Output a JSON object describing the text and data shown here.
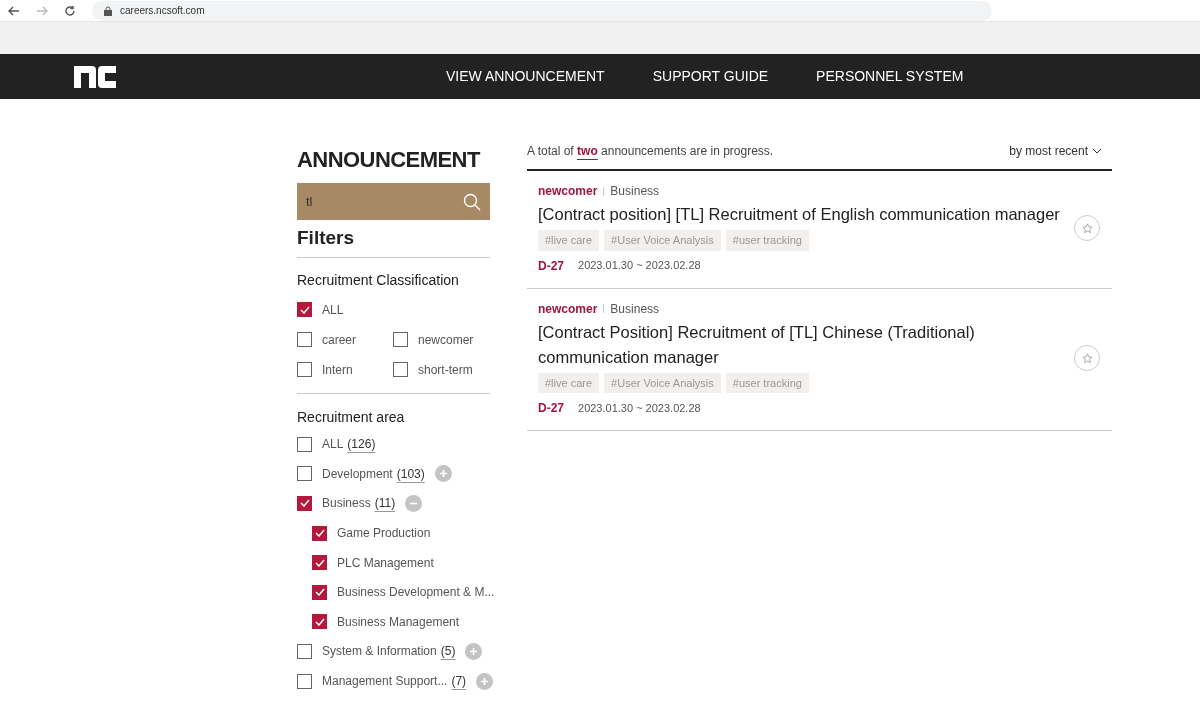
{
  "browser": {
    "url": "careers.ncsoft.com"
  },
  "nav": {
    "items": [
      "VIEW ANNOUNCEMENT",
      "SUPPORT GUIDE",
      "PERSONNEL SYSTEM"
    ]
  },
  "sidebar": {
    "title": "ANNOUNCEMENT",
    "search": {
      "value": "tl"
    },
    "filters_title": "Filters",
    "classification": {
      "title": "Recruitment Classification",
      "options": [
        {
          "label": "ALL",
          "checked": true
        },
        {
          "label": "career",
          "checked": false
        },
        {
          "label": "newcomer",
          "checked": false
        },
        {
          "label": "Intern",
          "checked": false
        },
        {
          "label": "short-term",
          "checked": false
        }
      ]
    },
    "area": {
      "title": "Recruitment area",
      "options": [
        {
          "label": "ALL",
          "count": "(126)",
          "checked": false
        },
        {
          "label": "Development",
          "count": "(103)",
          "checked": false,
          "expanded": false
        },
        {
          "label": "Business",
          "count": "(11)",
          "checked": true,
          "expanded": true,
          "children": [
            {
              "label": "Game Production",
              "checked": true
            },
            {
              "label": "PLC Management",
              "checked": true
            },
            {
              "label": "Business Development & M...",
              "checked": true
            },
            {
              "label": "Business Management",
              "checked": true
            }
          ]
        },
        {
          "label": "System & Information",
          "count": "(5)",
          "checked": false,
          "expanded": false
        },
        {
          "label": "Management Support...",
          "count": "(7)",
          "checked": false,
          "expanded": false
        }
      ]
    }
  },
  "results": {
    "summary": "A total of **two** announcements are in progress.",
    "sort": "by most recent",
    "announcements": [
      {
        "type": "newcomer",
        "area": "Business",
        "title": "[Contract position] [TL] Recruitment of English communication manager",
        "tags": [
          "#live care",
          "#User Voice Analysis",
          "#user tracking"
        ],
        "dday": "D-27",
        "period": "2023.01.30 ~ 2023.02.28",
        "starred": false
      },
      {
        "type": "newcomer",
        "area": "Business",
        "title": "[Contract Position] Recruitment of [TL] Chinese (Traditional) communication manager",
        "tags": [
          "#live care",
          "#User Voice Analysis",
          "#user tracking"
        ],
        "dday": "D-27",
        "period": "2023.01.30 ~ 2023.02.28",
        "starred": false
      }
    ]
  }
}
